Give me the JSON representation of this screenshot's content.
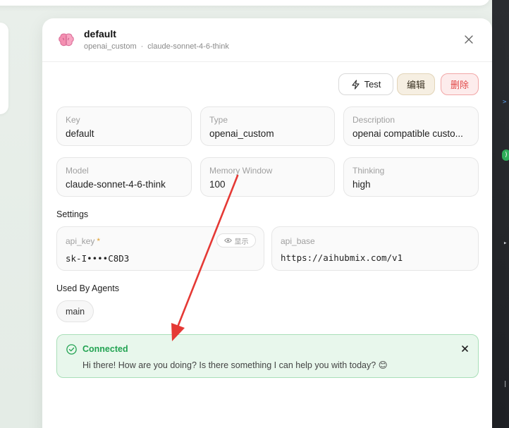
{
  "modal": {
    "title": "default",
    "subtitle_provider": "openai_custom",
    "subtitle_separator": "·",
    "subtitle_model": "claude-sonnet-4-6-think"
  },
  "actions": {
    "test_label": "Test",
    "edit_label": "编辑",
    "delete_label": "删除"
  },
  "fields": [
    {
      "label": "Key",
      "value": "default"
    },
    {
      "label": "Type",
      "value": "openai_custom"
    },
    {
      "label": "Description",
      "value": "openai compatible custo..."
    },
    {
      "label": "Model",
      "value": "claude-sonnet-4-6-think"
    },
    {
      "label": "Memory Window",
      "value": "100"
    },
    {
      "label": "Thinking",
      "value": "high"
    }
  ],
  "settings": {
    "section_label": "Settings",
    "api_key": {
      "label": "api_key",
      "required_mark": "*",
      "value": "sk-I••••C8D3",
      "show_label": "显示"
    },
    "api_base": {
      "label": "api_base",
      "value": "https://aihubmix.com/v1"
    }
  },
  "agents": {
    "section_label": "Used By Agents",
    "items": [
      "main"
    ]
  },
  "alert": {
    "title": "Connected",
    "message": "Hi there! How are you doing? Is there something I can help you with today? 😊"
  },
  "colors": {
    "success": "#22a352",
    "danger": "#e24a4a",
    "annotation_arrow": "#e53935"
  },
  "icons": [
    "brain-icon",
    "close-icon",
    "lightning-icon",
    "eye-icon",
    "check-circle-icon",
    "close-x-icon"
  ]
}
